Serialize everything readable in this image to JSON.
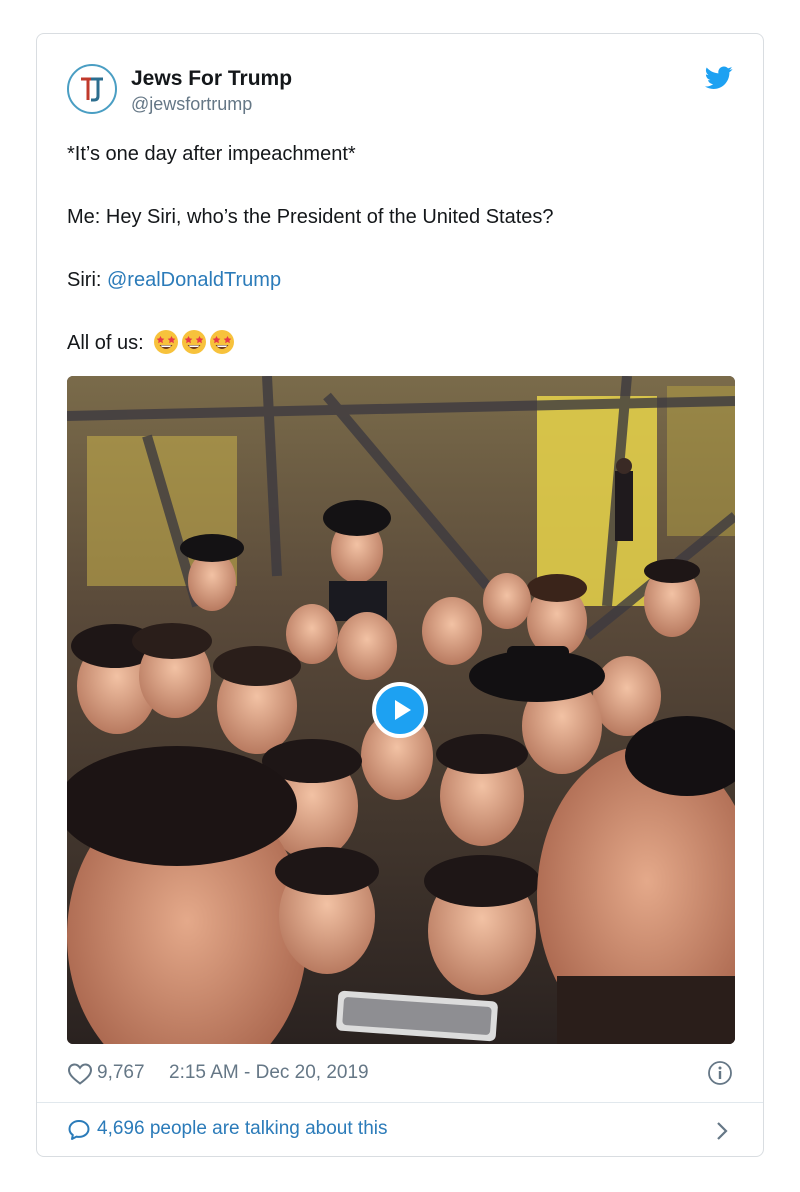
{
  "tweet": {
    "author": {
      "display_name": "Jews For Trump",
      "handle": "@jewsfortrump",
      "avatar_icon": "jt-monogram-logo"
    },
    "brand_icon": "twitter-bird-icon",
    "brand_color": "#1da1f2",
    "link_color": "#2b7bb9",
    "lines": {
      "line1": "*It’s one day after impeachment*",
      "line2": "Me: Hey Siri, who’s the President of the United States?",
      "line3_prefix": "Siri: ",
      "line3_mention": "@realDonaldTrump",
      "line4_prefix": "All of us: "
    },
    "emojis": [
      "star-struck-emoji",
      "star-struck-emoji",
      "star-struck-emoji"
    ],
    "media": {
      "type": "video",
      "play_icon": "play-icon"
    },
    "likes": "9,767",
    "timestamp": "2:15 AM - Dec 20, 2019",
    "talking": "4,696 people are talking about this"
  }
}
